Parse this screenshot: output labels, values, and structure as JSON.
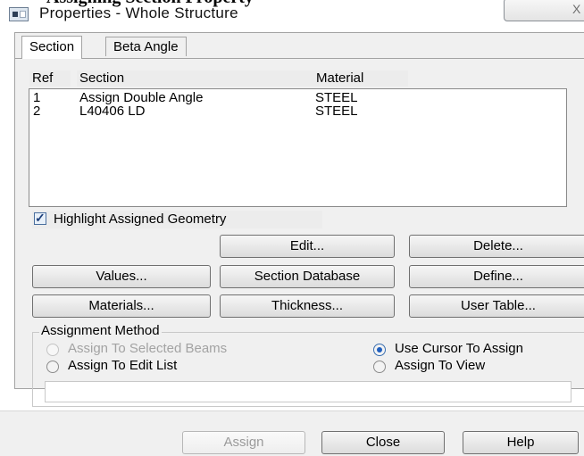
{
  "caption": "Assigning Section Property",
  "window": {
    "title": "Properties - Whole Structure",
    "close_glyph": "X"
  },
  "tabs": [
    {
      "label": "Section",
      "active": true
    },
    {
      "label": "Beta Angle",
      "active": false
    }
  ],
  "table": {
    "columns": [
      "Ref",
      "Section",
      "Material"
    ],
    "rows": [
      {
        "ref": "1",
        "section": "Assign Double Angle",
        "material": "STEEL"
      },
      {
        "ref": "2",
        "section": "L40406 LD",
        "material": "STEEL"
      }
    ]
  },
  "highlight": {
    "label": "Highlight Assigned Geometry",
    "checked": true
  },
  "buttons": {
    "edit": "Edit...",
    "delete": "Delete...",
    "values": "Values...",
    "section_database": "Section Database",
    "define": "Define...",
    "materials": "Materials...",
    "thickness": "Thickness...",
    "user_table": "User Table..."
  },
  "assignment": {
    "title": "Assignment Method",
    "options": [
      {
        "label": "Assign To Selected Beams",
        "selected": false,
        "enabled": false
      },
      {
        "label": "Use Cursor To Assign",
        "selected": true,
        "enabled": true
      },
      {
        "label": "Assign To Edit List",
        "selected": false,
        "enabled": true
      },
      {
        "label": "Assign To View",
        "selected": false,
        "enabled": true
      }
    ],
    "input_value": ""
  },
  "footer": {
    "assign": "Assign",
    "close": "Close",
    "help": "Help"
  }
}
